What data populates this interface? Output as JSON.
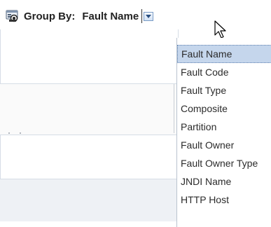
{
  "toolbar": {
    "group_icon": "group-by-icon",
    "label": "Group By:",
    "value": "Fault Name",
    "dropdown_icon": "chevron-down-icon"
  },
  "dropdown": {
    "selected_index": 0,
    "options": [
      "Fault Name",
      "Fault Code",
      "Fault Type",
      "Composite",
      "Partition",
      "Fault Owner",
      "Fault Owner Type",
      "JNDI Name",
      "HTTP Host"
    ]
  },
  "colors": {
    "selected_bg": "#c5d6ec",
    "selected_border": "#5c7fae",
    "dropdown_button": "#d3e2f5"
  }
}
